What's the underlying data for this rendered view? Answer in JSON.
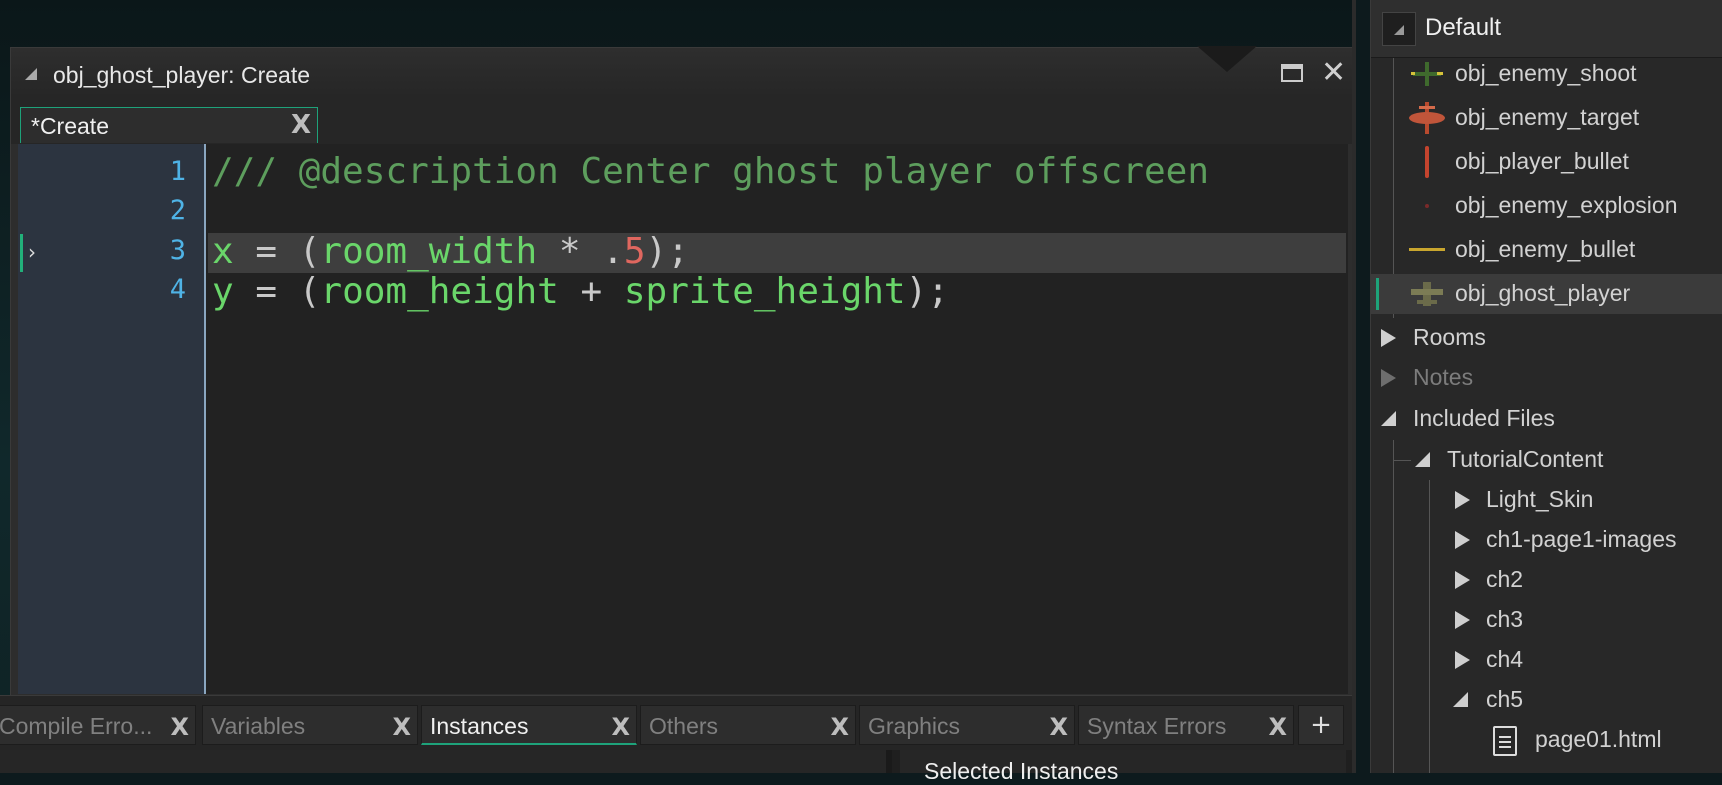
{
  "code_window": {
    "title": "obj_ghost_player: Create",
    "tab_label": "*Create",
    "tab_close": "X",
    "line_numbers": [
      "1",
      "2",
      "3",
      "4"
    ],
    "code": {
      "line1": "/// @description Center ghost player offscreen",
      "line3": {
        "a": "x",
        "b": " = (",
        "c": "room_width",
        "d": " * .",
        "e": "5",
        "f": ");"
      },
      "line4": {
        "a": "y",
        "b": " = (",
        "c": "room_height",
        "d": " + ",
        "e": "sprite_height",
        "f": ");"
      }
    }
  },
  "bottom_tabs": [
    {
      "label": "Compile Erro...",
      "close": "X"
    },
    {
      "label": "Variables",
      "close": "X"
    },
    {
      "label": "Instances",
      "close": "X"
    },
    {
      "label": "Others",
      "close": "X"
    },
    {
      "label": "Graphics",
      "close": "X"
    },
    {
      "label": "Syntax Errors",
      "close": "X"
    }
  ],
  "add_tab": "+",
  "selected_instances": "Selected Instances",
  "resource_tree": {
    "header": "Default",
    "objects": [
      {
        "label": "obj_enemy_shoot",
        "icon": "plane-sprite-icon"
      },
      {
        "label": "obj_enemy_target",
        "icon": "target-sprite-icon"
      },
      {
        "label": "obj_player_bullet",
        "icon": "bullet-sprite-icon"
      },
      {
        "label": "obj_enemy_explosion",
        "icon": "explosion-sprite-icon"
      },
      {
        "label": "obj_enemy_bullet",
        "icon": "bullet-sprite-icon"
      },
      {
        "label": "obj_ghost_player",
        "icon": "player-sprite-icon"
      }
    ],
    "groups": {
      "rooms": "Rooms",
      "notes": "Notes",
      "included_files": "Included Files",
      "tutorial_content": "TutorialContent",
      "light_skin": "Light_Skin",
      "ch1": "ch1-page1-images",
      "ch2": "ch2",
      "ch3": "ch3",
      "ch4": "ch4",
      "ch5": "ch5",
      "page01": "page01.html"
    }
  },
  "colors": {
    "accent": "#1ea27a",
    "comment": "#5d9e5d",
    "identifier": "#6ad66a",
    "number": "#e0675f",
    "line_number": "#4fb3e6"
  }
}
